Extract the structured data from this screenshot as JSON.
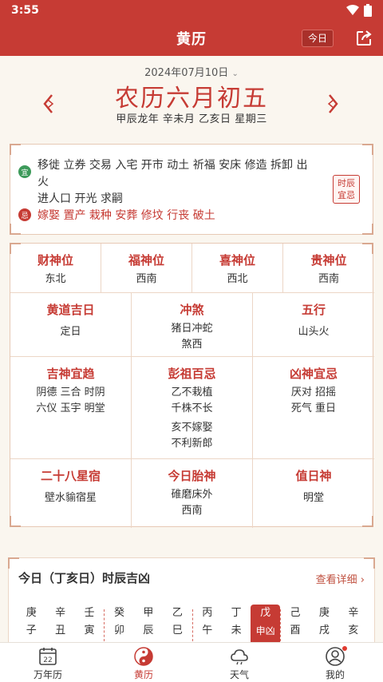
{
  "status": {
    "time": "3:55"
  },
  "header": {
    "title": "黄历",
    "today_label": "今日"
  },
  "date": {
    "solar": "2024年07月10日",
    "lunar": "农历六月初五",
    "ganzhi": "甲辰龙年 辛未月 乙亥日 星期三"
  },
  "yiji": {
    "yi_badge": "宜",
    "yi_line1": "移徙 立券 交易 入宅 开市 动土 祈福 安床 修造 拆卸 出火",
    "yi_line2": "进人口 开光 求嗣",
    "ji_badge": "忌",
    "ji_text": "嫁娶 置产 栽种 安葬 修坟 行丧 破土",
    "shichen_btn_line1": "时辰",
    "shichen_btn_line2": "宜忌"
  },
  "gods": [
    {
      "label": "财神位",
      "value": "东北"
    },
    {
      "label": "福神位",
      "value": "西南"
    },
    {
      "label": "喜神位",
      "value": "西北"
    },
    {
      "label": "贵神位",
      "value": "西南"
    }
  ],
  "row2": [
    {
      "label": "黄道吉日",
      "lines": [
        "定日"
      ]
    },
    {
      "label": "冲煞",
      "lines": [
        "猪日冲蛇",
        "煞西"
      ]
    },
    {
      "label": "五行",
      "lines": [
        "山头火"
      ]
    }
  ],
  "row3": [
    {
      "label": "吉神宜趋",
      "lines": [
        "阴德 三合 时阴",
        "六仪 玉宇 明堂"
      ]
    },
    {
      "label": "彭祖百忌",
      "lines": [
        "乙不栽植",
        "千株不长",
        "亥不嫁娶",
        "不利新郎"
      ]
    },
    {
      "label": "凶神宜忌",
      "lines": [
        "厌对 招摇",
        "死气 重日"
      ]
    }
  ],
  "row4": [
    {
      "label": "二十八星宿",
      "lines": [
        "壁水貐宿星"
      ]
    },
    {
      "label": "今日胎神",
      "lines": [
        "碓磨床外",
        "西南"
      ]
    },
    {
      "label": "值日神",
      "lines": [
        "明堂"
      ]
    }
  ],
  "shichen": {
    "title": "今日（丁亥日）时辰吉凶",
    "more": "查看详细",
    "hours": [
      {
        "top": "庚",
        "bottom": "子"
      },
      {
        "top": "辛",
        "bottom": "丑"
      },
      {
        "top": "壬",
        "bottom": "寅"
      },
      {
        "top": "癸",
        "bottom": "卯"
      },
      {
        "top": "甲",
        "bottom": "辰"
      },
      {
        "top": "乙",
        "bottom": "巳"
      },
      {
        "top": "丙",
        "bottom": "午"
      },
      {
        "top": "丁",
        "bottom": "未"
      },
      {
        "top": "戊",
        "bottom": "申凶"
      },
      {
        "top": "己",
        "bottom": "酉"
      },
      {
        "top": "庚",
        "bottom": "戌"
      },
      {
        "top": "辛",
        "bottom": "亥"
      }
    ]
  },
  "tabs": [
    {
      "label": "万年历",
      "icon": "calendar-icon",
      "icon_text": "22"
    },
    {
      "label": "黄历",
      "icon": "yinyang-icon"
    },
    {
      "label": "天气",
      "icon": "weather-icon"
    },
    {
      "label": "我的",
      "icon": "profile-icon"
    }
  ],
  "colors": {
    "primary": "#c63b34",
    "yi_green": "#3d9a5a",
    "background": "#faf6ef"
  }
}
